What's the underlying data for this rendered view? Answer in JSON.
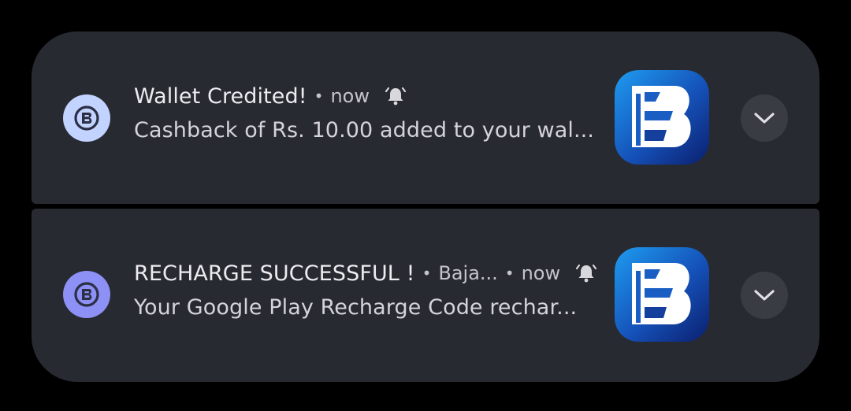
{
  "notifications": [
    {
      "title": "Wallet Credited!",
      "app_name": "",
      "time": "now",
      "text": "Cashback of Rs. 10.00 added to your wal...",
      "small_icon": "bajaj-finserv-logo-icon",
      "large_icon": "bajaj-finserv-app-icon",
      "alert_icon": "alarm-bell-icon",
      "expand_icon": "chevron-down-icon",
      "accent_color": "#c3d3ff"
    },
    {
      "title": "RECHARGE SUCCESSFUL !",
      "app_name": "Baja...",
      "time": "now",
      "text": "Your Google Play Recharge Code rechar...",
      "small_icon": "bajaj-finserv-logo-icon",
      "large_icon": "bajaj-finserv-app-icon",
      "alert_icon": "alarm-bell-icon",
      "expand_icon": "chevron-down-icon",
      "accent_color": "#8d90f4"
    }
  ],
  "colors": {
    "background": "#000000",
    "card": "#282a31",
    "expand_button": "#3a3c43"
  }
}
